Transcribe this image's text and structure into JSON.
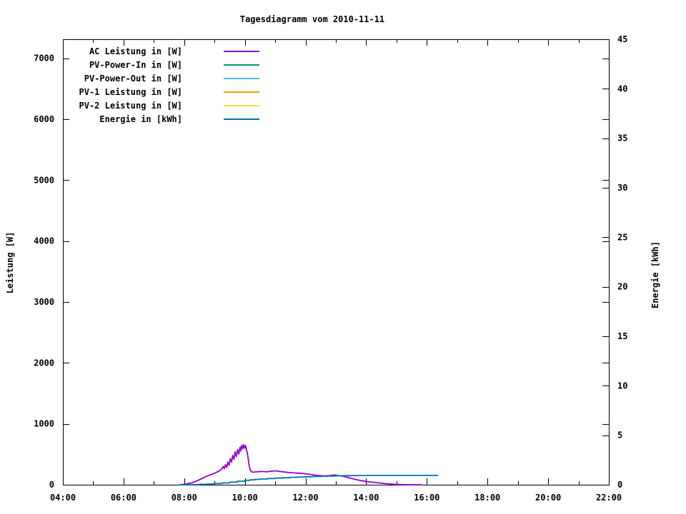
{
  "title": "Tagesdiagramm vom 2010-11-11",
  "axes": {
    "y_label": "Leistung [W]",
    "y2_label": "Energie [kWh]"
  },
  "chart_data": {
    "type": "line",
    "title": "Tagesdiagramm vom 2010-11-11",
    "xlabel": "",
    "ylabel": "Leistung [W]",
    "y2label": "Energie [kWh]",
    "grid": false,
    "legend_position": "top-left-inside",
    "x_ticks_major": [
      {
        "label": "04:00",
        "hour": 4
      },
      {
        "label": "06:00",
        "hour": 6
      },
      {
        "label": "08:00",
        "hour": 8
      },
      {
        "label": "10:00",
        "hour": 10
      },
      {
        "label": "12:00",
        "hour": 12
      },
      {
        "label": "14:00",
        "hour": 14
      },
      {
        "label": "16:00",
        "hour": 16
      },
      {
        "label": "18:00",
        "hour": 18
      },
      {
        "label": "20:00",
        "hour": 20
      },
      {
        "label": "22:00",
        "hour": 22
      }
    ],
    "x_minor_tick_every_hours": 1,
    "x_range_hours": [
      4,
      22
    ],
    "y_left": {
      "tick_values": [
        0,
        1000,
        2000,
        3000,
        4000,
        5000,
        6000,
        7000
      ],
      "range": [
        0,
        7312
      ]
    },
    "y_right": {
      "tick_values": [
        0,
        5,
        10,
        15,
        20,
        25,
        30,
        35,
        40,
        45
      ],
      "range": [
        0,
        45
      ]
    },
    "series": [
      {
        "name": "AC Leistung in [W]",
        "color": "#9400d3",
        "axis": "left",
        "style": "line",
        "points": [
          [
            7.83,
            0
          ],
          [
            7.95,
            3
          ],
          [
            8.05,
            10
          ],
          [
            8.17,
            22
          ],
          [
            8.3,
            40
          ],
          [
            8.42,
            62
          ],
          [
            8.55,
            95
          ],
          [
            8.7,
            130
          ],
          [
            8.85,
            160
          ],
          [
            8.95,
            178
          ],
          [
            9.05,
            200
          ],
          [
            9.15,
            225
          ],
          [
            9.22,
            248
          ],
          [
            9.28,
            300
          ],
          [
            9.32,
            262
          ],
          [
            9.36,
            330
          ],
          [
            9.4,
            285
          ],
          [
            9.44,
            372
          ],
          [
            9.48,
            320
          ],
          [
            9.52,
            430
          ],
          [
            9.56,
            370
          ],
          [
            9.6,
            480
          ],
          [
            9.64,
            420
          ],
          [
            9.68,
            540
          ],
          [
            9.72,
            465
          ],
          [
            9.76,
            575
          ],
          [
            9.8,
            505
          ],
          [
            9.84,
            615
          ],
          [
            9.87,
            555
          ],
          [
            9.9,
            648
          ],
          [
            9.93,
            592
          ],
          [
            9.96,
            655
          ],
          [
            9.99,
            600
          ],
          [
            10.02,
            645
          ],
          [
            10.05,
            575
          ],
          [
            10.08,
            520
          ],
          [
            10.11,
            430
          ],
          [
            10.14,
            320
          ],
          [
            10.18,
            235
          ],
          [
            10.25,
            205
          ],
          [
            10.4,
            212
          ],
          [
            10.55,
            218
          ],
          [
            10.7,
            212
          ],
          [
            10.85,
            222
          ],
          [
            11.0,
            228
          ],
          [
            11.15,
            218
          ],
          [
            11.3,
            208
          ],
          [
            11.45,
            200
          ],
          [
            11.6,
            195
          ],
          [
            11.75,
            190
          ],
          [
            11.9,
            185
          ],
          [
            12.05,
            178
          ],
          [
            12.2,
            165
          ],
          [
            12.35,
            155
          ],
          [
            12.5,
            149
          ],
          [
            12.65,
            143
          ],
          [
            12.8,
            150
          ],
          [
            12.95,
            160
          ],
          [
            13.05,
            152
          ],
          [
            13.15,
            148
          ],
          [
            13.3,
            132
          ],
          [
            13.45,
            112
          ],
          [
            13.6,
            92
          ],
          [
            13.8,
            70
          ],
          [
            14.0,
            54
          ],
          [
            14.2,
            42
          ],
          [
            14.4,
            30
          ],
          [
            14.6,
            20
          ],
          [
            14.8,
            12
          ],
          [
            15.0,
            5
          ],
          [
            15.15,
            2
          ],
          [
            15.3,
            0
          ],
          [
            15.83,
            0
          ]
        ]
      },
      {
        "name": "PV-Power-In in [W]",
        "color": "#009e73",
        "axis": "left",
        "style": "line",
        "points": []
      },
      {
        "name": "PV-Power-Out in [W]",
        "color": "#56b4e9",
        "axis": "left",
        "style": "line",
        "points": []
      },
      {
        "name": "PV-1 Leistung in [W]",
        "color": "#e69f00",
        "axis": "left",
        "style": "line",
        "points": []
      },
      {
        "name": "PV-2 Leistung in [W]",
        "color": "#f0e442",
        "axis": "left",
        "style": "line",
        "points": []
      },
      {
        "name": "Energie in [kWh]",
        "color": "#0072b2",
        "axis": "right",
        "style": "steps",
        "points": [
          [
            7.83,
            0
          ],
          [
            8.25,
            0.01
          ],
          [
            8.5,
            0.04
          ],
          [
            8.75,
            0.08
          ],
          [
            9.0,
            0.12
          ],
          [
            9.25,
            0.18
          ],
          [
            9.5,
            0.26
          ],
          [
            9.75,
            0.35
          ],
          [
            10.0,
            0.45
          ],
          [
            10.17,
            0.5
          ],
          [
            10.33,
            0.54
          ],
          [
            10.5,
            0.58
          ],
          [
            10.75,
            0.63
          ],
          [
            11.0,
            0.67
          ],
          [
            11.25,
            0.71
          ],
          [
            11.5,
            0.75
          ],
          [
            11.75,
            0.78
          ],
          [
            12.0,
            0.81
          ],
          [
            12.25,
            0.84
          ],
          [
            12.5,
            0.86
          ],
          [
            12.75,
            0.88
          ],
          [
            13.0,
            0.9
          ],
          [
            13.25,
            0.915
          ],
          [
            13.5,
            0.925
          ],
          [
            13.75,
            0.93
          ],
          [
            14.0,
            0.935
          ],
          [
            14.5,
            0.94
          ],
          [
            15.0,
            0.945
          ],
          [
            16.37,
            0.945
          ]
        ]
      }
    ]
  }
}
